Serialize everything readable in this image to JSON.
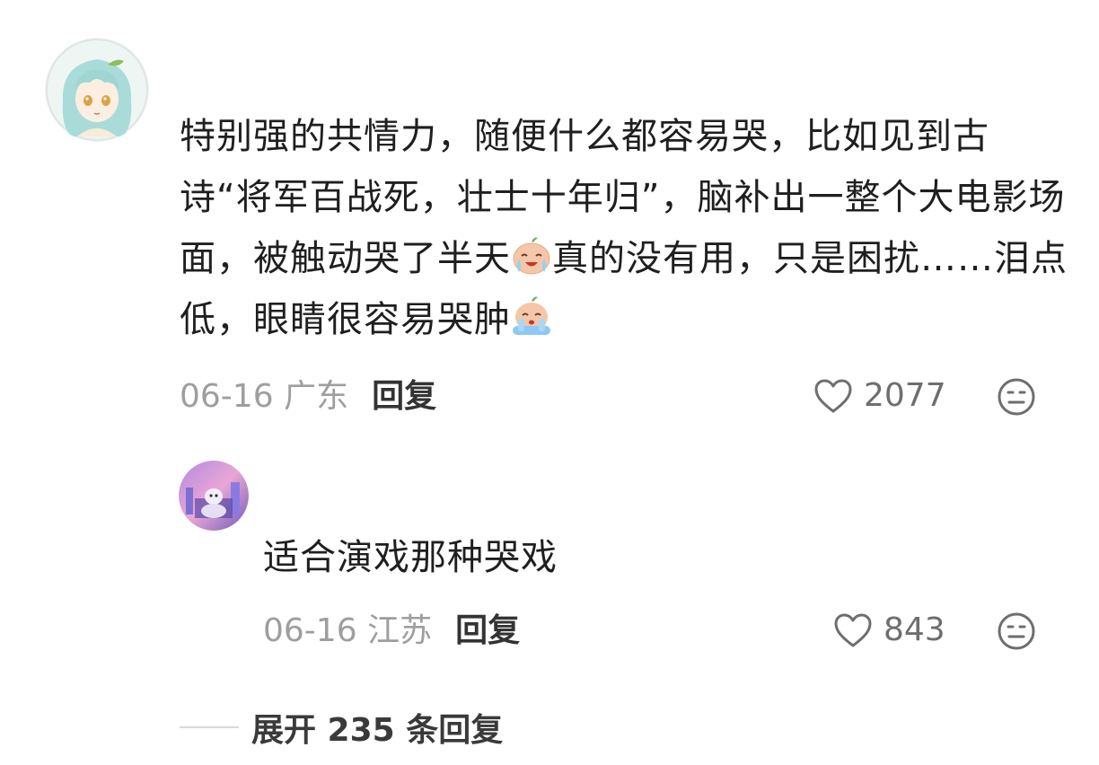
{
  "comment": {
    "text_part1": "特别强的共情力，随便什么都容易哭，比如见到古诗“将军百战死，壮士十年归”，脑补出一整个大电影场面，被触动哭了半天",
    "text_part2": "真的没有用，只是困扰……泪点低，眼睛很容易哭肿",
    "emoji_1": "crying-face-emoji",
    "emoji_2": "sobbing-face-emoji",
    "date": "06-16",
    "location": "广东",
    "reply_label": "回复",
    "likes": "2077"
  },
  "reply": {
    "text": "适合演戏那种哭戏",
    "date": "06-16",
    "location": "江苏",
    "reply_label": "回复",
    "likes": "843"
  },
  "expand_replies": {
    "label": "展开 235 条回复"
  },
  "icons": {
    "like": "heart-outline-icon",
    "dislike": "meh-face-icon"
  }
}
